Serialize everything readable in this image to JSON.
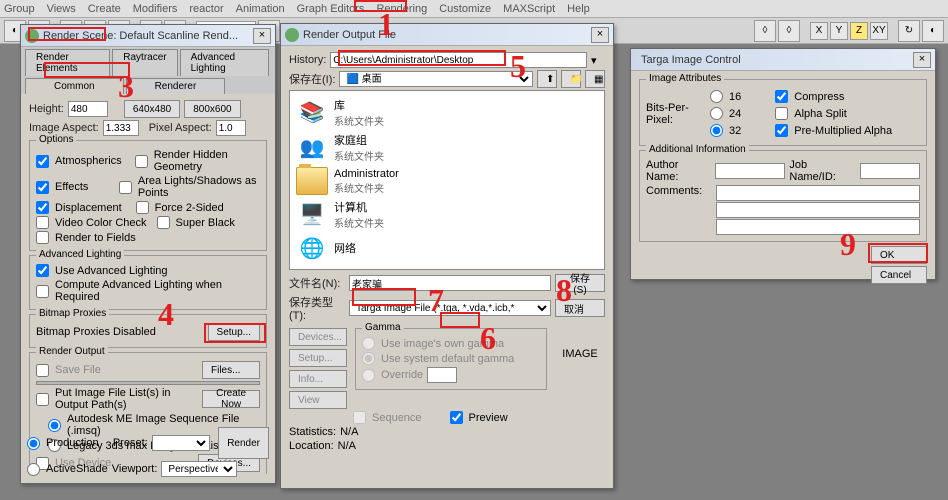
{
  "menubar": [
    "Group",
    "Views",
    "Create",
    "Modifiers",
    "reactor",
    "Animation",
    "Graph Editors",
    "Rendering",
    "Customize",
    "MAXScript",
    "Help"
  ],
  "toolbar": {
    "view_combo": "View",
    "axes": {
      "x": "X",
      "y": "Y",
      "z": "Z",
      "xy": "XY"
    }
  },
  "render_scene": {
    "title": "Render Scene: Default Scanline Rend...",
    "tabs": {
      "render_elements": "Render Elements",
      "raytracer": "Raytracer",
      "advanced_lighting": "Advanced Lighting",
      "common": "Common",
      "renderer": "Renderer"
    },
    "height_label": "Height:",
    "height_value": "480",
    "btn_640": "640x480",
    "btn_800": "800x600",
    "image_aspect_label": "Image Aspect:",
    "image_aspect_value": "1.333",
    "pixel_aspect_label": "Pixel Aspect:",
    "pixel_aspect_value": "1.0",
    "options_legend": "Options",
    "atmospherics": "Atmospherics",
    "render_hidden": "Render Hidden Geometry",
    "effects": "Effects",
    "area_lights": "Area Lights/Shadows as Points",
    "displacement": "Displacement",
    "force2sided": "Force 2-Sided",
    "video_color": "Video Color Check",
    "super_black": "Super Black",
    "render_to_fields": "Render to Fields",
    "adv_light_legend": "Advanced Lighting",
    "use_adv_light": "Use Advanced Lighting",
    "compute_adv": "Compute Advanced Lighting when Required",
    "bitmap_legend": "Bitmap Proxies",
    "bitmap_disabled": "Bitmap Proxies Disabled",
    "setup": "Setup...",
    "output_legend": "Render Output",
    "save_file": "Save File",
    "files": "Files...",
    "put_image": "Put Image File List(s) in Output Path(s)",
    "create_now": "Create Now",
    "autodesk_me": "Autodesk ME Image Sequence File (.imsq)",
    "legacy_ifl": "Legacy 3ds max Image File List (.ifl)",
    "use_device": "Use Device",
    "devices": "Devices...",
    "production": "Production",
    "active_shade": "ActiveShade",
    "preset_label": "Preset:",
    "preset_val": "",
    "viewport_label": "Viewport:",
    "viewport_val": "Perspective",
    "render_btn": "Render"
  },
  "file_dialog": {
    "title": "Render Output File",
    "history_label": "History:",
    "history_value": "C:\\Users\\Administrator\\Desktop",
    "save_in_label": "保存在(I):",
    "save_in_value": "桌面",
    "items": [
      {
        "name": "库",
        "sub": "系统文件夹",
        "icon": "lib"
      },
      {
        "name": "家庭组",
        "sub": "系统文件夹",
        "icon": "home"
      },
      {
        "name": "Administrator",
        "sub": "系统文件夹",
        "icon": "user"
      },
      {
        "name": "计算机",
        "sub": "系统文件夹",
        "icon": "computer"
      },
      {
        "name": "网络",
        "sub": "",
        "icon": "network"
      }
    ],
    "filename_label": "文件名(N):",
    "filename_value": "老家骗",
    "save_btn": "保存(S)",
    "filetype_label": "保存类型(T):",
    "filetype_value": "Targa Image File (*.tga, *.vda,*.icb,*",
    "cancel_btn": "取消",
    "devices_btn": "Devices...",
    "setup_btn": "Setup...",
    "info_btn": "Info...",
    "view_btn": "View",
    "gamma_legend": "Gamma",
    "gamma_own": "Use image's own gamma",
    "gamma_default": "Use system default gamma",
    "gamma_override": "Override",
    "sequence": "Sequence",
    "preview": "Preview",
    "image_label": "IMAGE",
    "stats_label": "Statistics:",
    "stats_value": "N/A",
    "location_label": "Location:",
    "location_value": "N/A"
  },
  "targa": {
    "title": "Targa Image Control",
    "attrs_legend": "Image Attributes",
    "bpp_label": "Bits-Per-Pixel:",
    "bpp16": "16",
    "bpp24": "24",
    "bpp32": "32",
    "compress": "Compress",
    "alpha_split": "Alpha Split",
    "pre_mult": "Pre-Multiplied Alpha",
    "addl_legend": "Additional Information",
    "author_label": "Author Name:",
    "jobname_label": "Job Name/ID:",
    "comments_label": "Comments:",
    "ok": "OK",
    "cancel": "Cancel"
  },
  "annotations": {
    "n1": "1",
    "n3": "3",
    "n4": "4",
    "n5": "5",
    "n6": "6",
    "n7": "7",
    "n8": "8",
    "n9": "9"
  }
}
